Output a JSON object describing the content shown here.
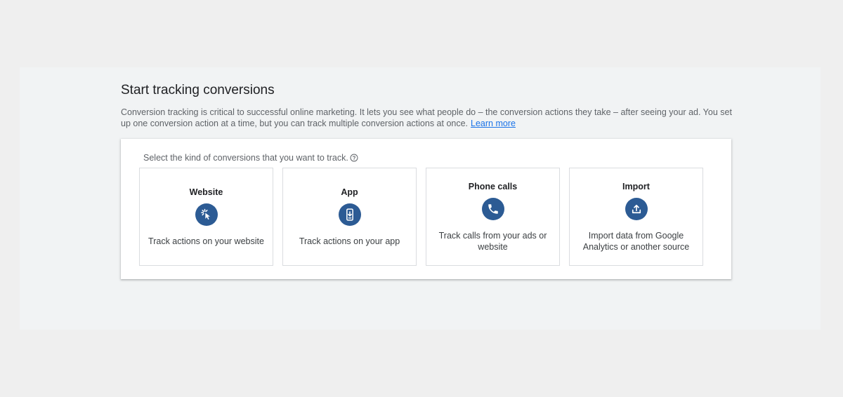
{
  "page": {
    "title": "Start tracking conversions",
    "description": "Conversion tracking is critical to successful online marketing. It lets you see what people do – the conversion actions they take – after seeing your ad. You set up one conversion action at a time, but you can track multiple conversion actions at once.",
    "learn_more": "Learn more"
  },
  "selector": {
    "prompt": "Select the kind of conversions that you want to track.",
    "help_icon": "help-circle-icon",
    "options": [
      {
        "title": "Website",
        "icon": "cursor-click-icon",
        "description": "Track actions on your website"
      },
      {
        "title": "App",
        "icon": "smartphone-download-icon",
        "description": "Track actions on your app"
      },
      {
        "title": "Phone calls",
        "icon": "phone-icon",
        "description": "Track calls from your ads or website"
      },
      {
        "title": "Import",
        "icon": "upload-icon",
        "description": "Import data from Google Analytics or another source"
      }
    ]
  },
  "colors": {
    "icon_circle": "#2c5b94",
    "link": "#1a73e8",
    "background": "#efefef"
  }
}
